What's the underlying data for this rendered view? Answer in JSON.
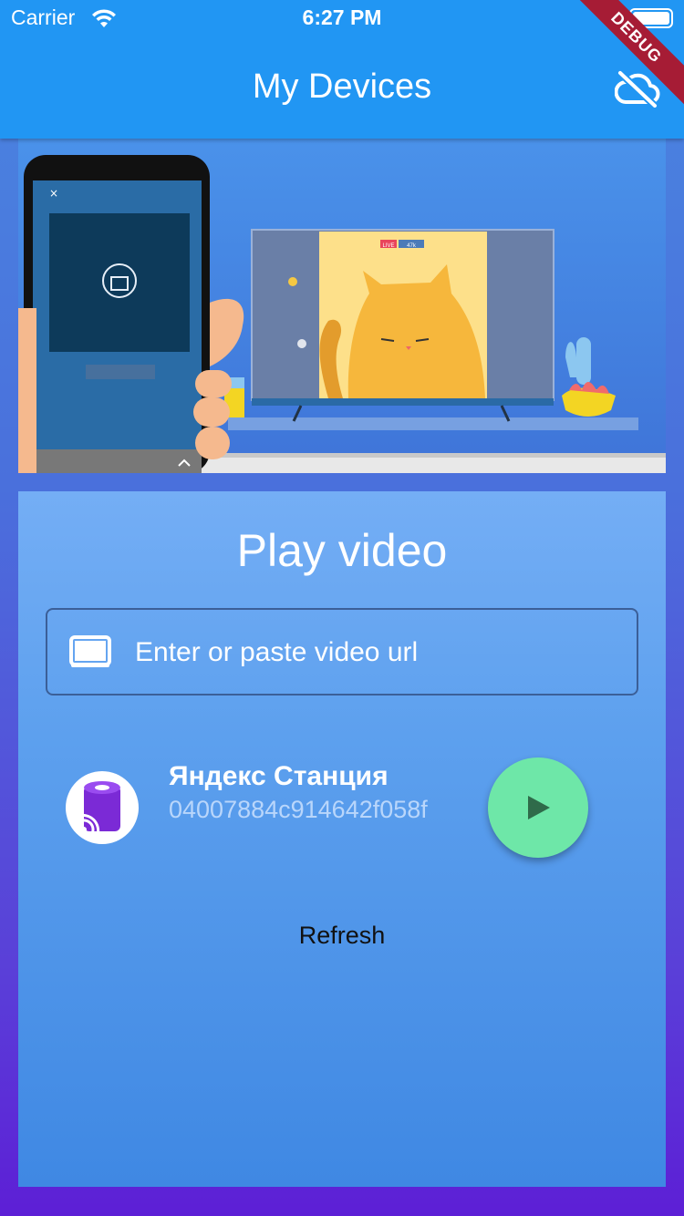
{
  "status_bar": {
    "carrier": "Carrier",
    "time": "6:27 PM"
  },
  "app_bar": {
    "title": "My Devices",
    "debug_banner": "DEBUG",
    "action_icon": "cloud-off-icon"
  },
  "hero": {
    "live_badge": "LIVE",
    "viewer_count": "47k"
  },
  "play_card": {
    "title": "Play video",
    "url_input": {
      "placeholder": "Enter or paste video url",
      "value": "",
      "icon": "tv-icon"
    },
    "devices": [
      {
        "name": "Яндекс Станция",
        "id": "04007884c914642f058f",
        "action_icon": "play-icon"
      }
    ],
    "refresh_label": "Refresh"
  },
  "colors": {
    "app_bar": "#2196f3",
    "play_button": "#6ee7a8",
    "device_id": "#b9d6fb",
    "debug_banner": "#a61c35"
  }
}
